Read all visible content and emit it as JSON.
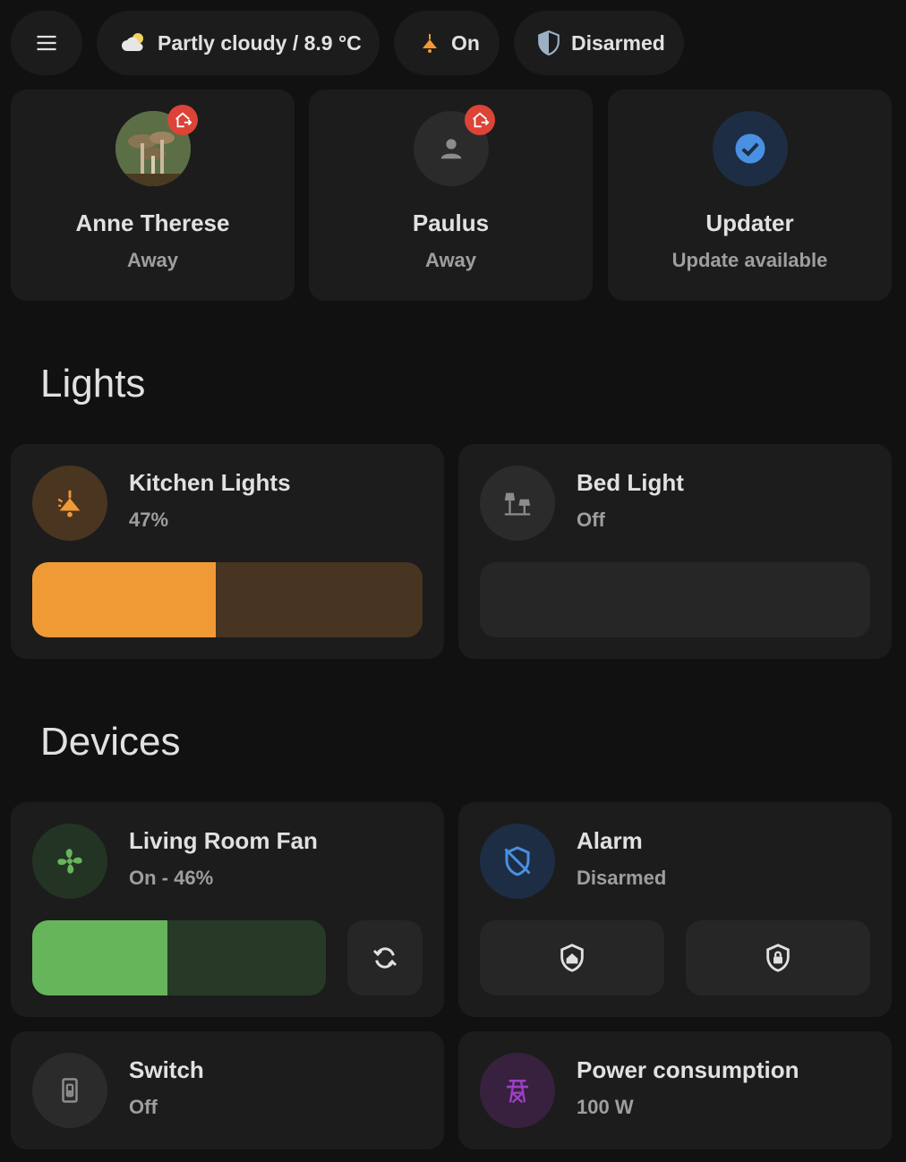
{
  "topbar": {
    "menu_icon": "menu-icon",
    "weather": {
      "icon": "partly-cloudy-icon",
      "label": "Partly cloudy / 8.9 °C"
    },
    "light_status": {
      "icon": "ceiling-light-icon",
      "label": "On",
      "color": "#f09a36"
    },
    "alarm_status": {
      "icon": "shield-half-icon",
      "label": "Disarmed"
    }
  },
  "persons": [
    {
      "name": "Anne Therese",
      "state": "Away",
      "avatar": "photo-avatar",
      "badge_icon": "home-export-icon"
    },
    {
      "name": "Paulus",
      "state": "Away",
      "avatar": "person-icon",
      "badge_icon": "home-export-icon"
    },
    {
      "name": "Updater",
      "state": "Update available",
      "icon": "check-circle-icon",
      "color": "#4a90e2"
    }
  ],
  "sections": {
    "lights": "Lights",
    "devices": "Devices"
  },
  "lights": [
    {
      "name": "Kitchen Lights",
      "state": "47%",
      "brightness": 0.47,
      "icon": "ceiling-light-icon",
      "color": "#f09a36"
    },
    {
      "name": "Bed Light",
      "state": "Off",
      "brightness": 0,
      "icon": "lamps-icon"
    }
  ],
  "devices": {
    "fan": {
      "name": "Living Room Fan",
      "state": "On - 46%",
      "speed": 0.46,
      "icon": "fan-icon",
      "oscillate_icon": "sync-icon",
      "color": "#66b55b"
    },
    "alarm": {
      "name": "Alarm",
      "state": "Disarmed",
      "icon": "shield-off-icon",
      "arm_home_icon": "shield-home-icon",
      "arm_away_icon": "shield-lock-icon",
      "color": "#4a90e2"
    },
    "switch": {
      "name": "Switch",
      "state": "Off",
      "icon": "light-switch-icon"
    },
    "power": {
      "name": "Power consumption",
      "state": "100 W",
      "icon": "transmission-tower-icon",
      "color": "#9c3fc4"
    }
  }
}
